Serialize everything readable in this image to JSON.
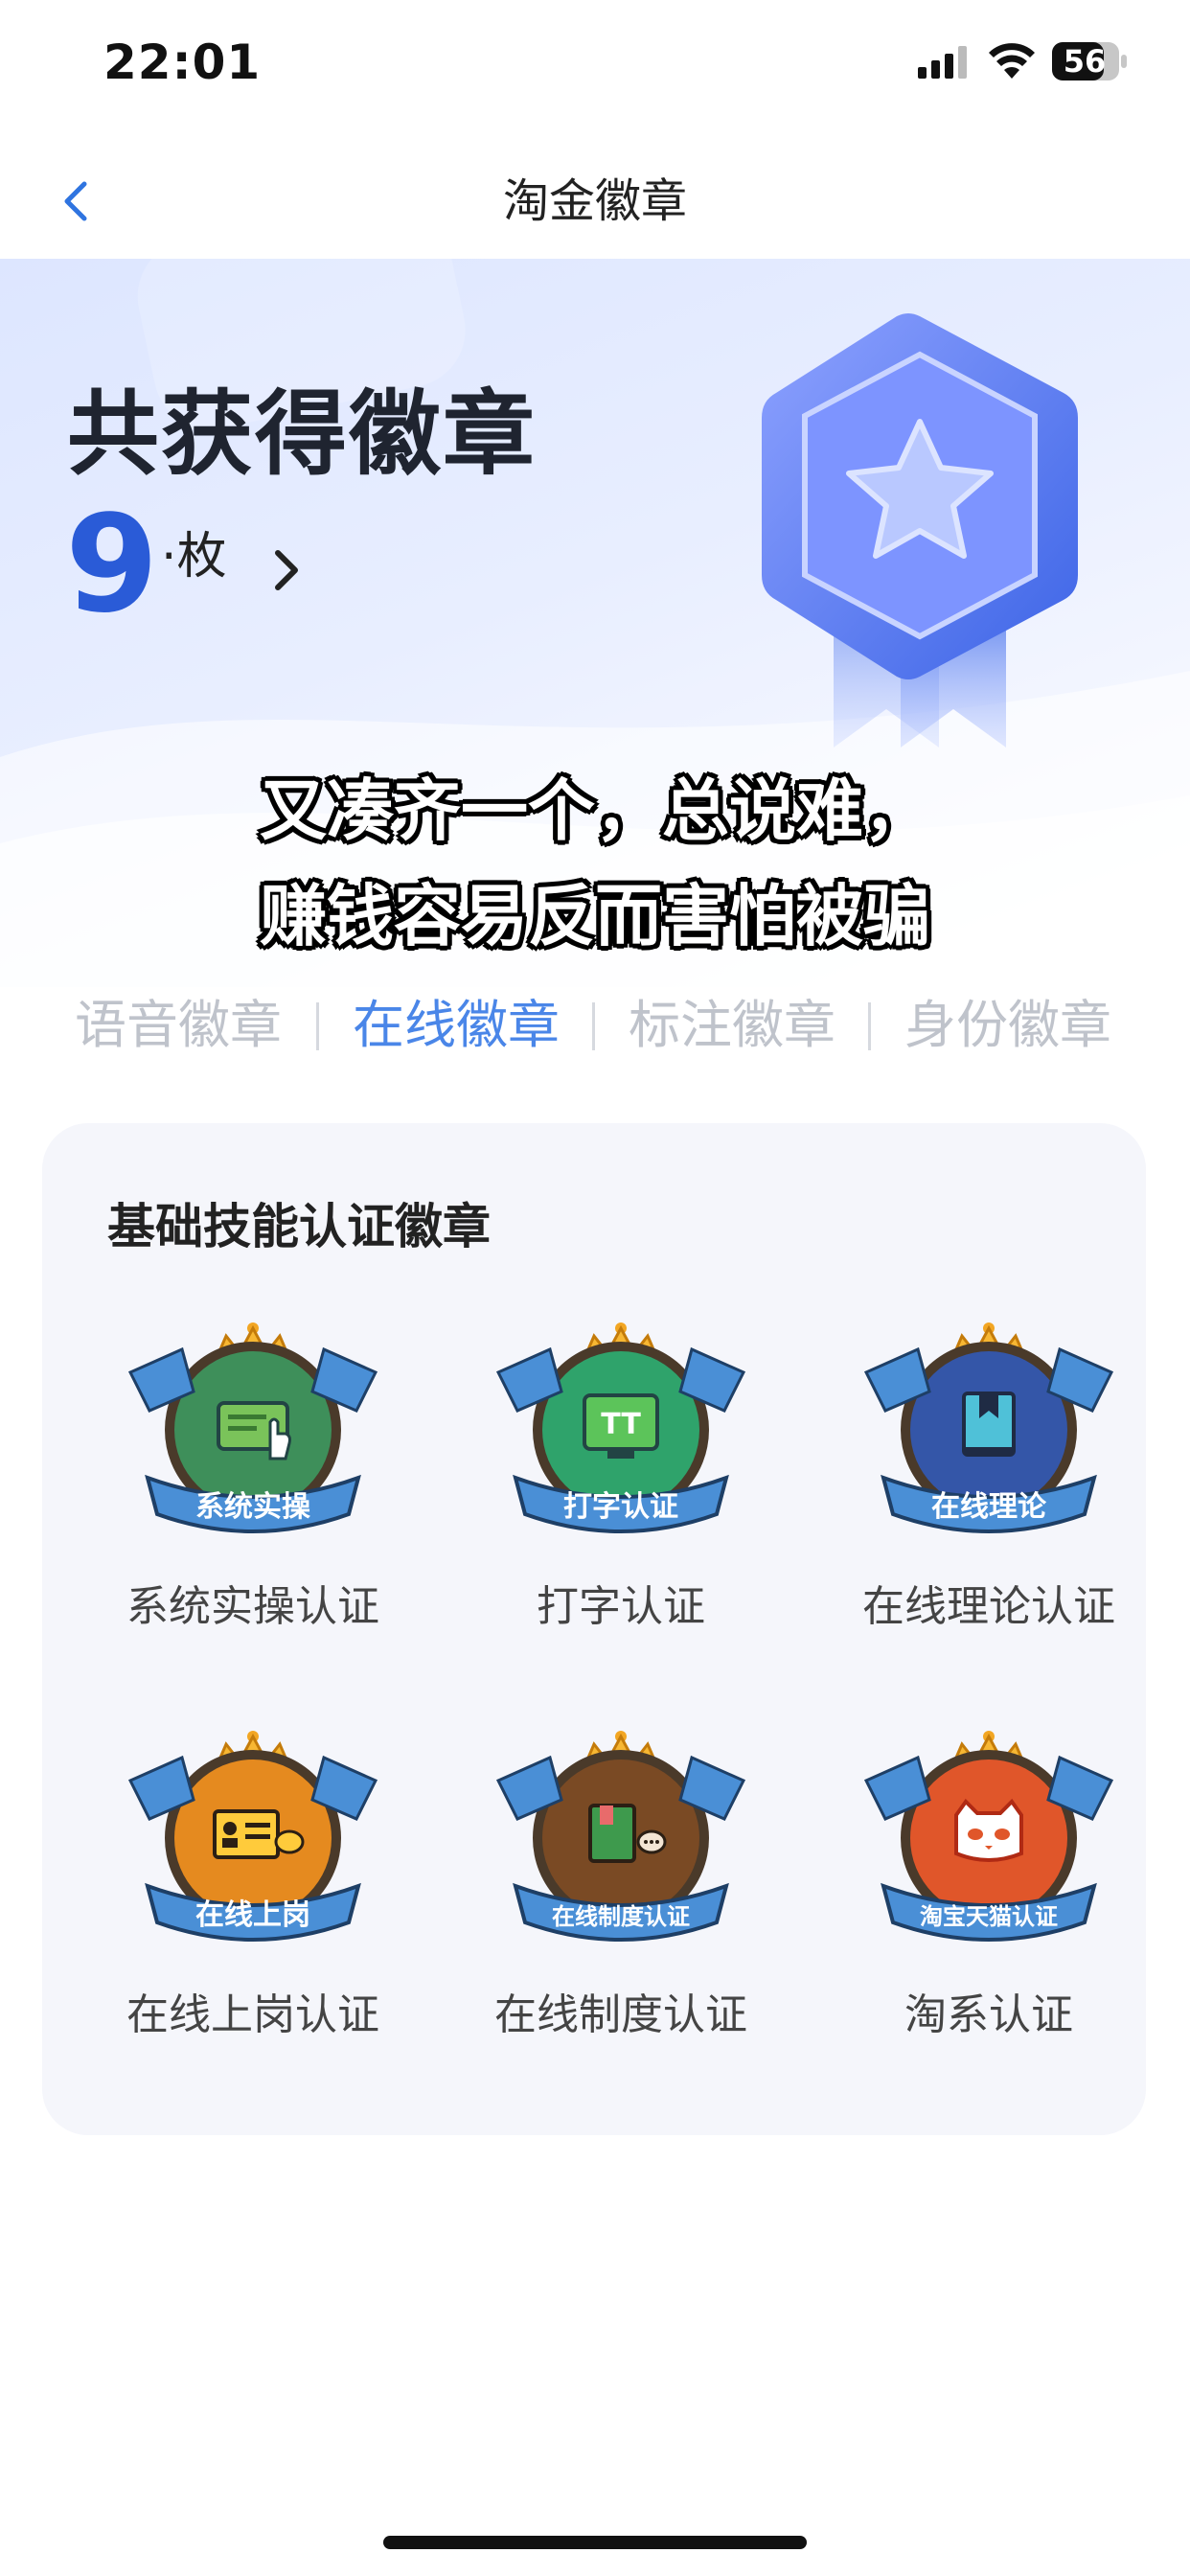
{
  "status_bar": {
    "time": "22:01",
    "battery": "56"
  },
  "nav": {
    "title": "淘金徽章"
  },
  "hero": {
    "title": "共获得徽章",
    "count": "9",
    "unit": "·枚"
  },
  "caption": {
    "line1": "又凑齐一个，总说难，",
    "line2": "赚钱容易反而害怕被骗"
  },
  "tabs": [
    {
      "label": "语音徽章",
      "active": false
    },
    {
      "label": "在线徽章",
      "active": true
    },
    {
      "label": "标注徽章",
      "active": false
    },
    {
      "label": "身份徽章",
      "active": false
    }
  ],
  "section": {
    "title": "基础技能认证徽章",
    "badges": [
      {
        "label": "系统实操认证",
        "banner": "系统实操",
        "color": "#3e8f5a",
        "icon": "screen-hand-icon"
      },
      {
        "label": "打字认证",
        "banner": "打字认证",
        "color": "#2fa36b",
        "icon": "monitor-tt-icon"
      },
      {
        "label": "在线理论认证",
        "banner": "在线理论",
        "color": "#3456a8",
        "icon": "book-icon"
      },
      {
        "label": "在线上岗认证",
        "banner": "在线上岗",
        "color": "#e58a1f",
        "icon": "id-card-icon"
      },
      {
        "label": "在线制度认证",
        "banner": "在线制度认证",
        "color": "#7a4a24",
        "icon": "book-chat-icon"
      },
      {
        "label": "淘系认证",
        "banner": "淘宝天猫认证",
        "color": "#e0562a",
        "icon": "tmall-cat-icon"
      }
    ]
  },
  "colors": {
    "accent": "#4a86e8",
    "count_blue": "#2a5bd7",
    "tab_inactive": "#bfc3cb"
  }
}
